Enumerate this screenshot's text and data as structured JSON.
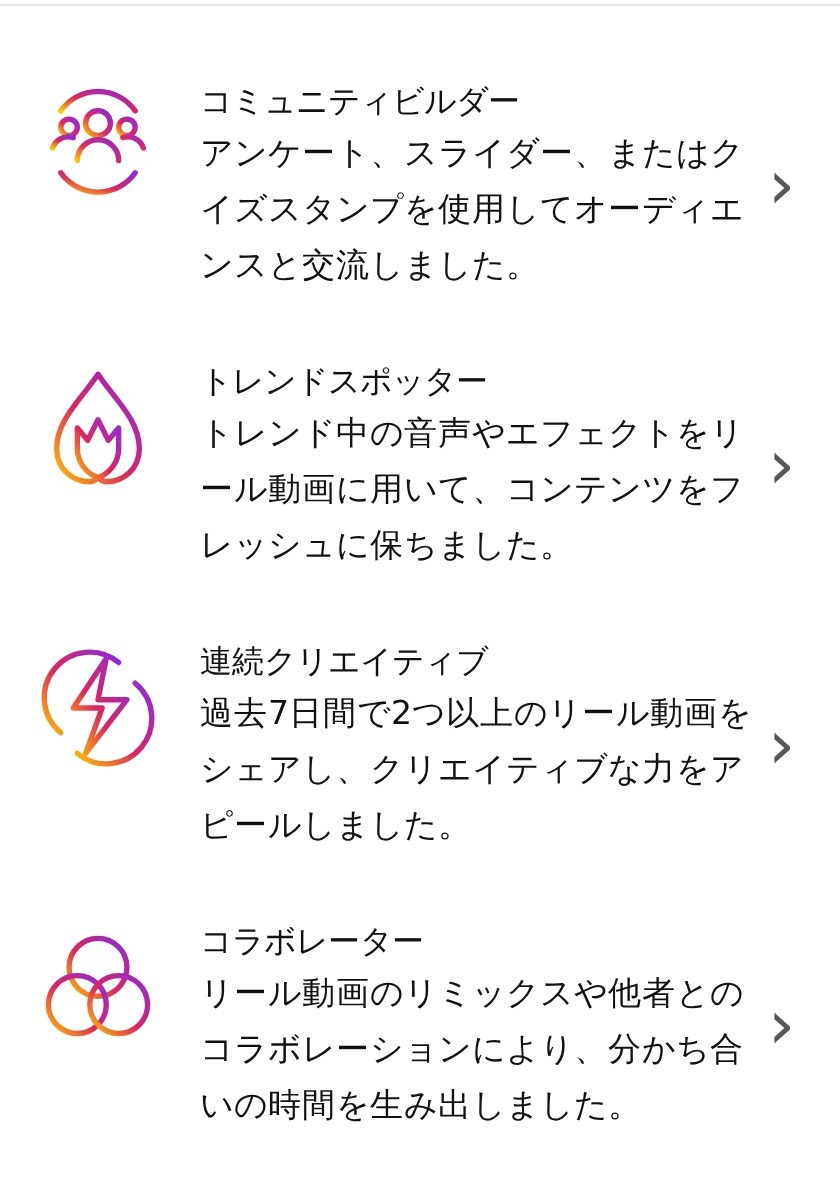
{
  "items": [
    {
      "title": "コミュニティビルダー",
      "description": "アンケート、スライダー、またはクイズスタンプを使用してオーディエンスと交流しました。",
      "chevron": "›"
    },
    {
      "title": "トレンドスポッター",
      "description": "トレンド中の音声やエフェクトをリール動画に用いて、コンテンツをフレッシュに保ちました。",
      "chevron": "›"
    },
    {
      "title": "連続クリエイティブ",
      "description": "過去7日間で2つ以上のリール動画をシェアし、クリエイティブな力をアピールしました。",
      "chevron": "›"
    },
    {
      "title": "コラボレーター",
      "description": "リール動画のリミックスや他者とのコラボレーションにより、分かち合いの時間を生み出しました。",
      "chevron": "›"
    }
  ]
}
